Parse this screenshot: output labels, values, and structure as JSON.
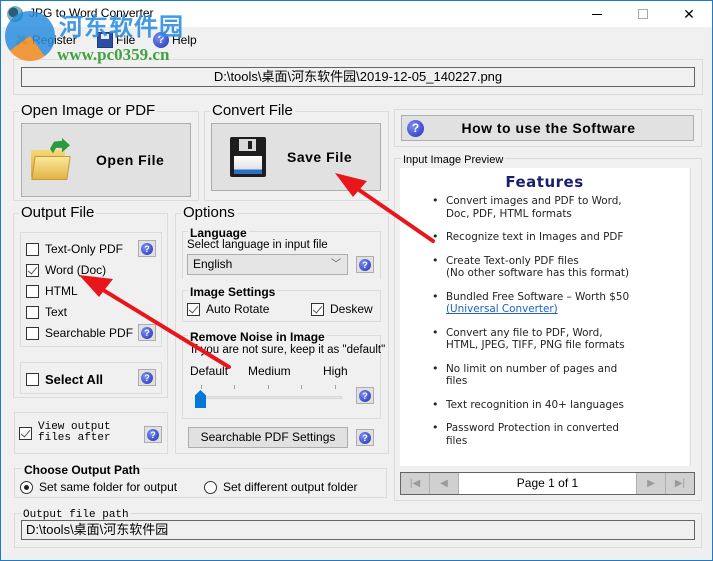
{
  "window": {
    "title": "JPG to Word Converter",
    "controls": {
      "minimize": "minimize",
      "maximize": "maximize",
      "close": "close"
    }
  },
  "watermark": {
    "site_name": "河东软件园",
    "url": "www.pc0359.cn"
  },
  "menu": {
    "items": [
      {
        "label": "Register",
        "icon": "key-icon"
      },
      {
        "label": "File",
        "icon": "floppy-icon"
      },
      {
        "label": "Help",
        "icon": "help-icon"
      }
    ]
  },
  "input_path": "D:\\tools\\桌面\\河东软件园\\2019-12-05_140227.png",
  "open_group": {
    "title": "Open Image or PDF",
    "button_label": "Open File"
  },
  "convert_group": {
    "title": "Convert File",
    "button_label": "Save File"
  },
  "output_file": {
    "title": "Output File",
    "options": [
      {
        "label": "Text-Only PDF",
        "checked": false,
        "has_help": true
      },
      {
        "label": "Word (Doc)",
        "checked": true,
        "has_help": false
      },
      {
        "label": "HTML",
        "checked": false,
        "has_help": false
      },
      {
        "label": "Text",
        "checked": false,
        "has_help": false
      },
      {
        "label": "Searchable PDF",
        "checked": false,
        "has_help": true
      }
    ],
    "select_all": {
      "label": "Select All",
      "checked": false
    },
    "view_after": {
      "label_line1": "View output",
      "label_line2": "files after",
      "checked": true
    }
  },
  "options": {
    "title": "Options",
    "language": {
      "title": "Language",
      "hint": "Select language in input file",
      "selected": "English"
    },
    "image_settings": {
      "title": "Image Settings",
      "auto_rotate": {
        "label": "Auto Rotate",
        "checked": true
      },
      "deskew": {
        "label": "Deskew",
        "checked": true
      }
    },
    "noise": {
      "title": "Remove Noise in Image",
      "hint": "If you are not sure, keep it as \"default\"",
      "labels": [
        "Default",
        "Medium",
        "High"
      ],
      "value_level": 0,
      "max_level": 4
    },
    "searchable_pdf_button": "Searchable PDF Settings"
  },
  "howto_button": "How to use the Software",
  "preview": {
    "title": "Input Image Preview",
    "heading": "Features",
    "items": [
      {
        "lines": [
          "Convert images and PDF to Word,",
          "Doc, PDF, HTML formats"
        ]
      },
      {
        "lines": [
          "Recognize text in Images and PDF"
        ]
      },
      {
        "lines": [
          "Create Text-only PDF files",
          "(No other software has this format)"
        ]
      },
      {
        "lines": [
          "Bundled Free Software – Worth $50"
        ],
        "link": "(Universal Converter)"
      },
      {
        "lines": [
          "Convert any file to PDF, Word,",
          "HTML, JPEG, TIFF, PNG file formats"
        ]
      },
      {
        "lines": [
          "No limit on number of pages and",
          "files"
        ]
      },
      {
        "lines": [
          "Text recognition in 40+ languages"
        ]
      },
      {
        "lines": [
          "Password Protection in converted",
          "files"
        ]
      }
    ],
    "pager": {
      "text": "Page 1 of 1",
      "first": "first-page",
      "prev": "previous-page",
      "next": "next-page",
      "last": "last-page"
    }
  },
  "output_path_group": {
    "title": "Choose Output Path",
    "same_folder": {
      "label": "Set same folder for output",
      "selected": true
    },
    "different_folder": {
      "label": "Set different output folder",
      "selected": false
    }
  },
  "output_file_path": {
    "title": "Output file path",
    "value": "D:\\tools\\桌面\\河东软件园"
  },
  "colors": {
    "window_border": "#1c7ccc",
    "annotation_arrow": "#e8161b",
    "slider_thumb": "#0078d7",
    "feature_heading": "#1a1e6e",
    "link": "#2060c0"
  }
}
